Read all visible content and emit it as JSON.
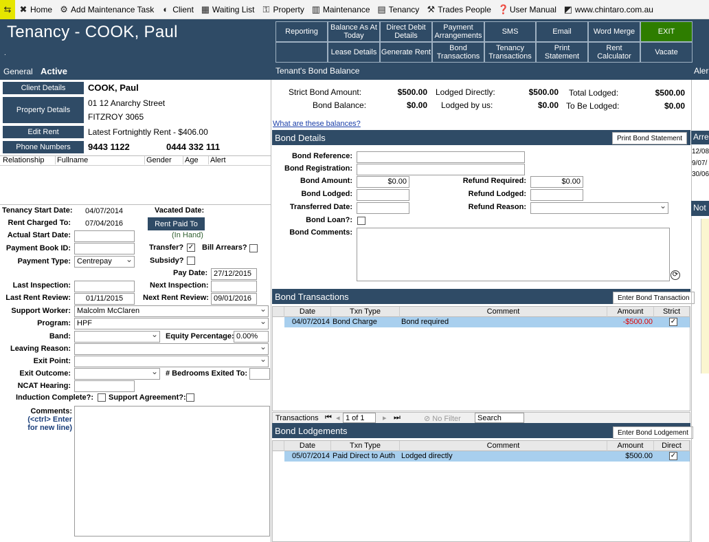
{
  "toolbar": {
    "items": [
      {
        "label": "Home",
        "icon": "home-icon"
      },
      {
        "label": "Add Maintenance Task",
        "icon": "maintenance-task-icon"
      },
      {
        "label": "Client",
        "icon": "client-icon"
      },
      {
        "label": "Waiting List",
        "icon": "waiting-list-icon"
      },
      {
        "label": "Property",
        "icon": "key-icon"
      },
      {
        "label": "Maintenance",
        "icon": "trash-icon"
      },
      {
        "label": "Tenancy",
        "icon": "calendar-icon"
      },
      {
        "label": "Trades People",
        "icon": "trades-icon"
      },
      {
        "label": "User Manual",
        "icon": "help-icon"
      },
      {
        "label": "www.chintaro.com.au",
        "icon": "chart-icon"
      }
    ]
  },
  "header": {
    "title": "Tenancy - COOK, Paul",
    "dot": ".",
    "buttons_row1": [
      "Reporting",
      "Balance As At Today",
      "Direct Debit Details",
      "Payment Arrangements",
      "SMS",
      "Email",
      "Word Merge",
      "EXIT"
    ],
    "buttons_row2": [
      "",
      "Lease Details",
      "Generate Rent",
      "Bond Transactions",
      "Tenancy Transactions",
      "Print Statement",
      "Rent Calculator",
      "Vacate"
    ],
    "exit_color": "#2e7d00"
  },
  "status": {
    "general": "General",
    "active": "Active",
    "bond_balance_title": "Tenant's Bond Balance",
    "alerts_cut": "Aler"
  },
  "client": {
    "client_details_btn": "Client Details",
    "property_details_btn": "Property Details",
    "edit_rent_btn": "Edit Rent",
    "phone_numbers_btn": "Phone Numbers",
    "name": "COOK, Paul",
    "address1": "01 12 Anarchy Street",
    "address2": "FITZROY 3065",
    "rent": "Latest Fortnightly Rent - $406.00",
    "phone1": "9443 1122",
    "phone2": "0444 332 111"
  },
  "relationships": {
    "headers": [
      "Relationship",
      "Fullname",
      "Gender",
      "Age",
      "Alert"
    ]
  },
  "tenancy": {
    "start_date_label": "Tenancy Start Date:",
    "start_date": "04/07/2014",
    "vacated_label": "Vacated Date:",
    "rent_charged_label": "Rent Charged To:",
    "rent_charged": "07/04/2016",
    "rent_paid_btn": "Rent Paid To",
    "in_hand": "(In Hand)",
    "actual_start_label": "Actual Start Date:",
    "payment_book_label": "Payment Book ID:",
    "transfer_label": "Transfer?",
    "bill_arrears_label": "Bill Arrears?",
    "payment_type_label": "Payment Type:",
    "payment_type": "Centrepay",
    "subsidy_label": "Subsidy?",
    "pay_date_label": "Pay Date:",
    "pay_date": "27/12/2015",
    "last_inspection_label": "Last Inspection:",
    "next_inspection_label": "Next Inspection:",
    "last_rent_review_label": "Last Rent Review:",
    "last_rent_review": "01/11/2015",
    "next_rent_review_label": "Next Rent Review:",
    "next_rent_review": "09/01/2016",
    "support_worker_label": "Support Worker:",
    "support_worker": "Malcolm McClaren",
    "program_label": "Program:",
    "program": "HPF",
    "band_label": "Band:",
    "equity_label": "Equity Percentage:",
    "equity": "0.00%",
    "leaving_reason_label": "Leaving Reason:",
    "exit_point_label": "Exit Point:",
    "exit_outcome_label": "Exit Outcome:",
    "bedrooms_label": "# Bedrooms Exited To:",
    "ncat_label": "NCAT Hearing:",
    "induction_label": "Induction Complete?:",
    "support_agreement_label": "Support Agreement?:",
    "comments_label": "Comments:",
    "comments_hint1": "(<ctrl> Enter",
    "comments_hint2": "for new line)"
  },
  "bond_balance": {
    "strict_label": "Strict Bond Amount:",
    "strict": "$500.00",
    "lodged_directly_label": "Lodged Directly:",
    "lodged_directly": "$500.00",
    "total_lodged_label": "Total Lodged:",
    "total_lodged": "$500.00",
    "balance_label": "Bond Balance:",
    "balance": "$0.00",
    "lodged_by_us_label": "Lodged by us:",
    "lodged_by_us": "$0.00",
    "to_be_lodged_label": "To Be Lodged:",
    "to_be_lodged": "$0.00",
    "link": "What are these balances?"
  },
  "bond_details": {
    "title": "Bond Details",
    "print_btn": "Print Bond Statement",
    "reference_label": "Bond Reference:",
    "registration_label": "Bond Registration:",
    "amount_label": "Bond Amount:",
    "amount": "$0.00",
    "refund_required_label": "Refund Required:",
    "refund_required": "$0.00",
    "lodged_label": "Bond Lodged:",
    "refund_lodged_label": "Refund Lodged:",
    "transferred_label": "Transferred Date:",
    "refund_reason_label": "Refund Reason:",
    "loan_label": "Bond Loan?:",
    "comments_label": "Bond Comments:"
  },
  "bond_transactions": {
    "title": "Bond Transactions",
    "enter_btn": "Enter Bond Transaction",
    "headers": [
      "Date",
      "Txn Type",
      "Comment",
      "Amount",
      "Strict"
    ],
    "rows": [
      {
        "date": "04/07/2014",
        "type": "Bond Charge",
        "comment": "Bond required",
        "amount": "-$500.00"
      }
    ],
    "nav_label": "Transactions",
    "nav_pos": "1 of 1",
    "no_filter": "No Filter",
    "search": "Search"
  },
  "bond_lodgements": {
    "title": "Bond Lodgements",
    "enter_btn": "Enter Bond Lodgement",
    "headers": [
      "Date",
      "Txn Type",
      "Comment",
      "Amount",
      "Direct"
    ],
    "rows": [
      {
        "date": "05/07/2014",
        "type": "Paid Direct to Auth",
        "comment": "Lodged directly",
        "amount": "$500.00"
      }
    ]
  },
  "right_cut": {
    "arrears": "Arre",
    "dates": [
      "12/08",
      "9/07/",
      "30/06"
    ],
    "notes": "Not"
  }
}
